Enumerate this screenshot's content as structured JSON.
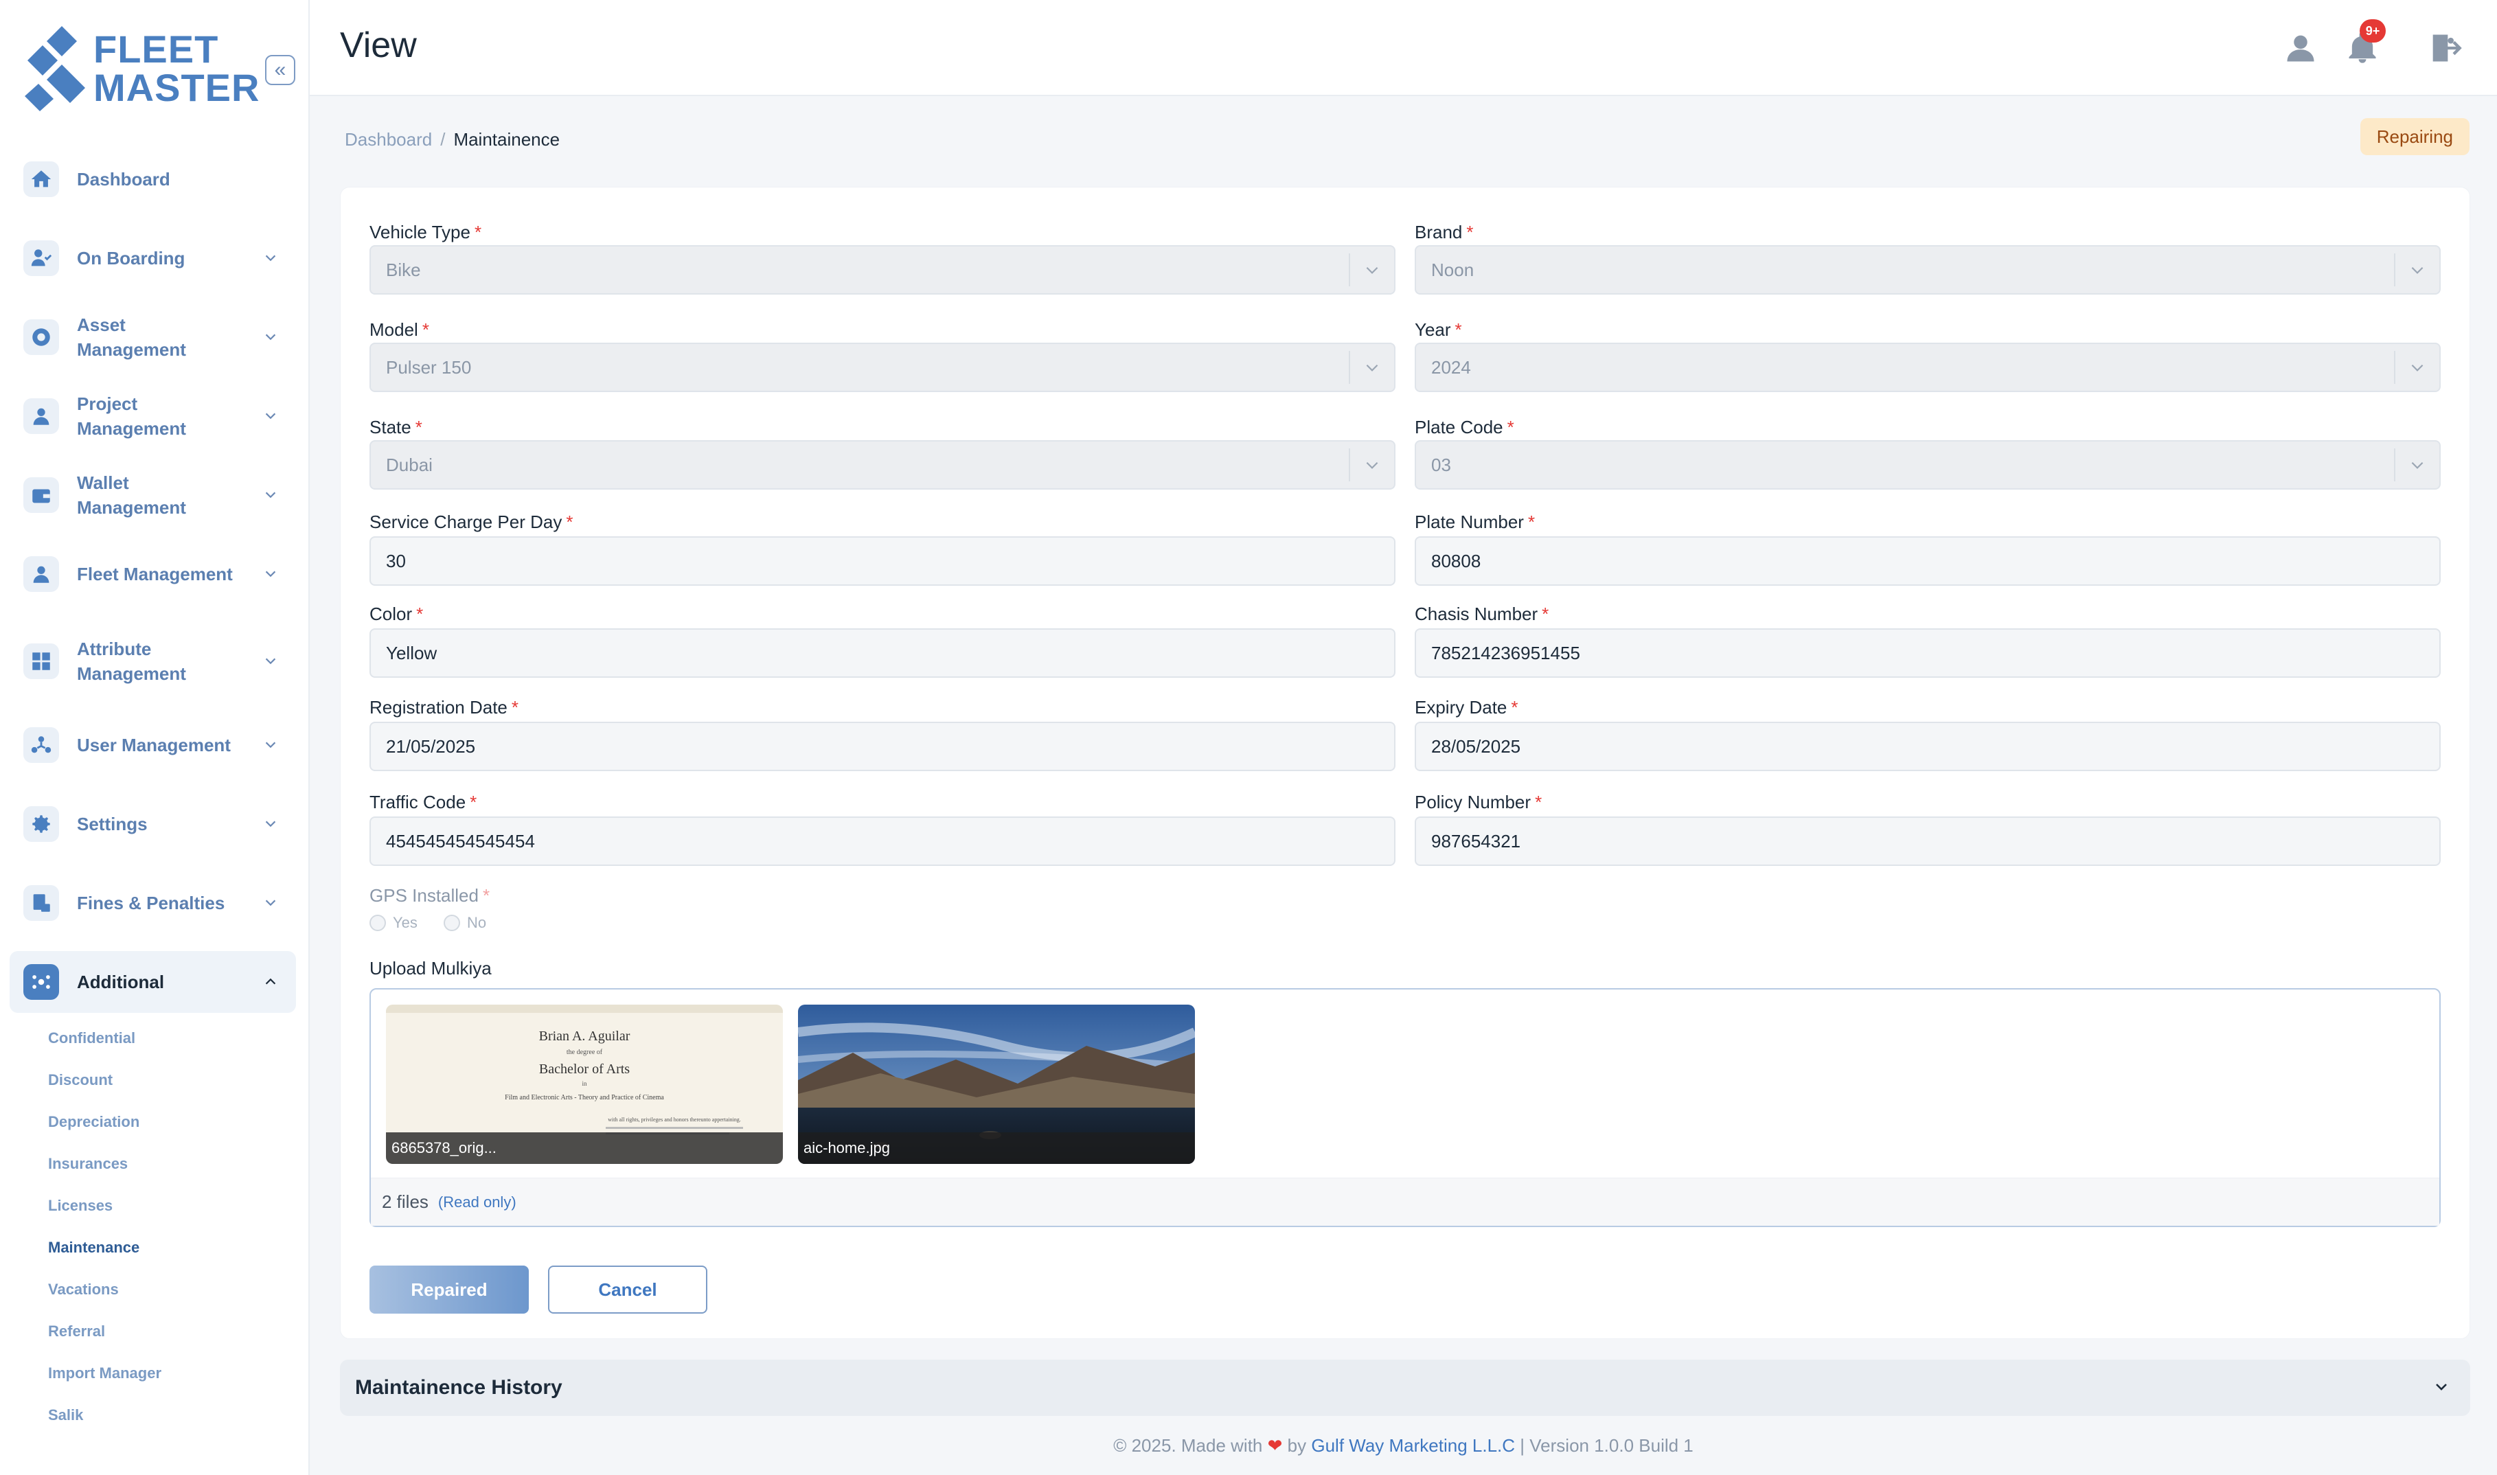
{
  "brand": {
    "line1": "FLEET",
    "line2": "MASTER",
    "accent_color": "#4a7fc0"
  },
  "sidebar": {
    "collapse_icon": "double-chevron-left-icon",
    "items": [
      {
        "label": "Dashboard",
        "icon": "home-icon",
        "expandable": false
      },
      {
        "label": "On Boarding",
        "icon": "user-check-icon",
        "expandable": true
      },
      {
        "label": "Asset Management",
        "icon": "asset-icon",
        "expandable": true
      },
      {
        "label": "Project Management",
        "icon": "project-icon",
        "expandable": true
      },
      {
        "label": "Wallet Management",
        "icon": "wallet-icon",
        "expandable": true
      },
      {
        "label": "Fleet Management",
        "icon": "fleet-icon",
        "expandable": true
      },
      {
        "label": "Attribute Management",
        "icon": "attribute-icon",
        "expandable": true
      },
      {
        "label": "User Management",
        "icon": "users-icon",
        "expandable": true
      },
      {
        "label": "Settings",
        "icon": "gear-icon",
        "expandable": true
      },
      {
        "label": "Fines & Penalties",
        "icon": "fines-icon",
        "expandable": true
      },
      {
        "label": "Additional",
        "icon": "additional-icon",
        "expandable": true,
        "active": true
      }
    ],
    "sub_items": [
      {
        "label": "Confidential"
      },
      {
        "label": "Discount"
      },
      {
        "label": "Depreciation"
      },
      {
        "label": "Insurances"
      },
      {
        "label": "Licenses"
      },
      {
        "label": "Maintenance",
        "active": true
      },
      {
        "label": "Vacations"
      },
      {
        "label": "Referral"
      },
      {
        "label": "Import Manager"
      },
      {
        "label": "Salik"
      }
    ]
  },
  "header": {
    "title": "View",
    "notification_badge": "9+",
    "icons": [
      "user-icon",
      "bell-icon",
      "logout-icon"
    ]
  },
  "breadcrumb": {
    "home": "Dashboard",
    "separator": "/",
    "current": "Maintainence"
  },
  "status": {
    "label": "Repairing",
    "bg": "#fde9c8",
    "color": "#9a4a12"
  },
  "form": {
    "vehicle_type": {
      "label": "Vehicle Type",
      "value": "Bike"
    },
    "brand": {
      "label": "Brand",
      "value": "Noon"
    },
    "model": {
      "label": "Model",
      "value": "Pulser 150"
    },
    "year": {
      "label": "Year",
      "value": "2024"
    },
    "state": {
      "label": "State",
      "value": "Dubai"
    },
    "plate_code": {
      "label": "Plate Code",
      "value": "03"
    },
    "service_charge": {
      "label": "Service Charge Per Day",
      "value": "30"
    },
    "plate_number": {
      "label": "Plate Number",
      "value": "80808"
    },
    "color": {
      "label": "Color",
      "value": "Yellow"
    },
    "chasis_number": {
      "label": "Chasis Number",
      "value": "785214236951455"
    },
    "registration_date": {
      "label": "Registration Date",
      "value": "21/05/2025"
    },
    "expiry_date": {
      "label": "Expiry Date",
      "value": "28/05/2025"
    },
    "traffic_code": {
      "label": "Traffic Code",
      "value": "454545454545454"
    },
    "policy_number": {
      "label": "Policy Number",
      "value": "987654321"
    },
    "gps": {
      "label": "GPS Installed",
      "options": [
        "Yes",
        "No"
      ]
    },
    "required_mark": "*"
  },
  "upload": {
    "label": "Upload Mulkiya",
    "files": [
      {
        "name": "6865378_orig...",
        "kind": "certificate"
      },
      {
        "name": "aic-home.jpg",
        "kind": "landscape"
      }
    ],
    "count_label": "2 files",
    "readonly_label": "(Read only)"
  },
  "certificate_text": {
    "name": "Brian A. Aguilar",
    "degree_intro": "the degree of",
    "degree": "Bachelor of Arts",
    "in": "in",
    "field": "Film and Electronic Arts - Theory and Practice of Cinema",
    "rights": "with all rights, privileges and honors thereunto appertaining."
  },
  "actions": {
    "primary": "Repaired",
    "secondary": "Cancel"
  },
  "history": {
    "title": "Maintainence History"
  },
  "footer": {
    "prefix": "© 2025. Made with",
    "by": "by",
    "company": "Gulf Way Marketing L.L.C",
    "version": "| Version 1.0.0 Build 1"
  }
}
